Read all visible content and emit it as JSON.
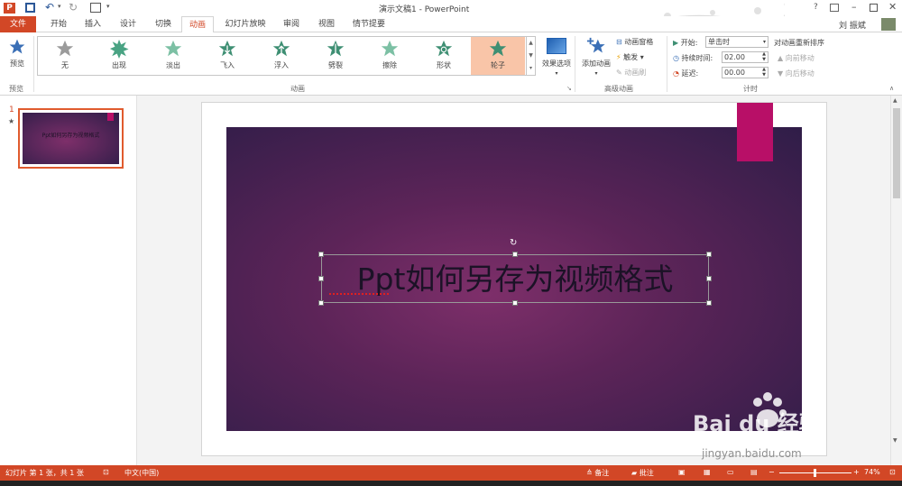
{
  "app": {
    "doc_title": "演示文稿1 - PowerPoint",
    "user": "刘 振斌",
    "help": "?"
  },
  "tabs": [
    "文件",
    "开始",
    "插入",
    "设计",
    "切换",
    "动画",
    "幻灯片放映",
    "审阅",
    "视图",
    "情节提要"
  ],
  "ribbon": {
    "preview": {
      "label": "预览",
      "group": "预览"
    },
    "animations": [
      {
        "label": "无",
        "color": "#9b9b9b"
      },
      {
        "label": "出现",
        "color": "#49a383"
      },
      {
        "label": "淡出",
        "color": "#7cc0a4"
      },
      {
        "label": "飞入",
        "color": "#3e8f73"
      },
      {
        "label": "浮入",
        "color": "#3e8f73"
      },
      {
        "label": "劈裂",
        "color": "#3e8f73"
      },
      {
        "label": "擦除",
        "color": "#7cc0a4"
      },
      {
        "label": "形状",
        "color": "#3e8f73"
      },
      {
        "label": "轮子",
        "color": "#3e8f73"
      }
    ],
    "effect_options": "效果选项",
    "animation_group": "动画",
    "add_animation": "添加动画",
    "animation_pane": "动画窗格",
    "trigger": "触发",
    "animation_painter": "动画刷",
    "advanced_group": "高级动画",
    "start_label": "开始:",
    "start_value": "单击时",
    "duration_label": "持续时间:",
    "duration_value": "02.00",
    "delay_label": "延迟:",
    "delay_value": "00.00",
    "reorder_title": "对动画重新排序",
    "move_earlier": "向前移动",
    "move_later": "向后移动",
    "timing_group": "计时"
  },
  "thumbnail": {
    "number": "1",
    "star": "★",
    "text": "Ppt如何另存为视频格式"
  },
  "slide": {
    "title": "Ppt如何另存为视频格式"
  },
  "watermark": {
    "brand": "Bai du 经验",
    "url": "jingyan.baidu.com"
  },
  "status": {
    "slide_info": "幻灯片 第 1 张，共 1 张",
    "language": "中文(中国)",
    "notes": "备注",
    "comments": "批注",
    "zoom": "74%"
  }
}
